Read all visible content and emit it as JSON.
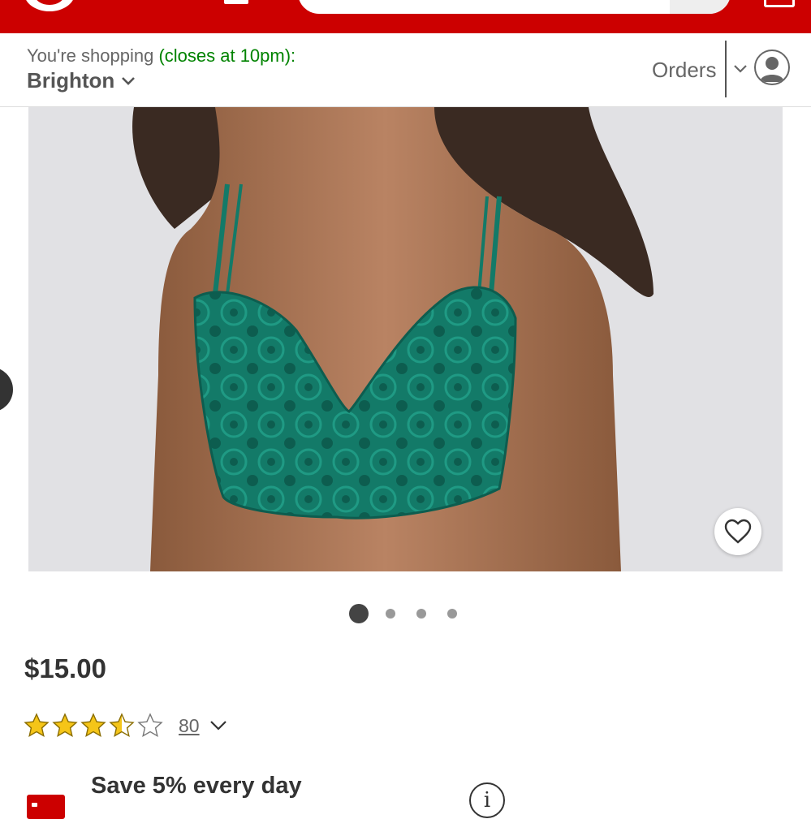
{
  "header": {
    "logo_icon": "target-bullseye-logo",
    "search_icon": "search-icon",
    "cart_icon": "cart-icon",
    "brand_color": "#cc0000"
  },
  "store_bar": {
    "shopping_prefix": "You're shopping",
    "hours": "(closes at 10pm):",
    "store_name": "Brighton",
    "orders_label": "Orders",
    "hours_color": "#008300"
  },
  "product": {
    "image_icon": "product-photo",
    "favorite_icon": "heart-icon",
    "carousel": {
      "total": 4,
      "active_index": 0
    },
    "price": "$15.00",
    "rating": {
      "value": 3.5,
      "max": 5,
      "count": "80"
    }
  },
  "savings": {
    "title": "Save 5% every day",
    "card_icon": "redcard-icon",
    "info_icon": "info-icon",
    "info_glyph": "i"
  }
}
